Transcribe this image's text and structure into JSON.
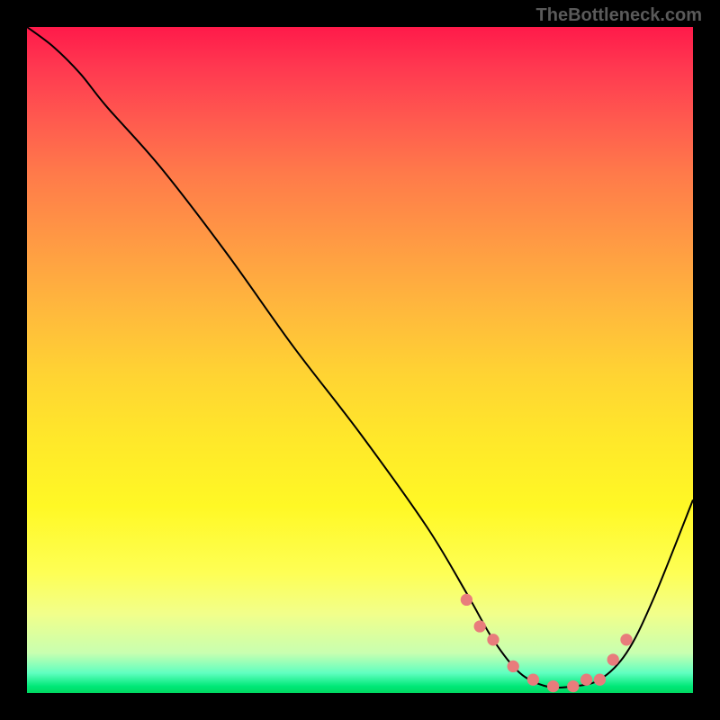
{
  "watermark": "TheBottleneck.com",
  "colors": {
    "background": "#000000",
    "curve": "#000000",
    "dots": "#e87c7c"
  },
  "chart_data": {
    "type": "line",
    "title": "",
    "xlabel": "",
    "ylabel": "",
    "xlim": [
      0,
      100
    ],
    "ylim": [
      0,
      100
    ],
    "series": [
      {
        "name": "bottleneck-curve",
        "x": [
          0,
          4,
          8,
          12,
          20,
          30,
          40,
          50,
          60,
          66,
          70,
          74,
          78,
          82,
          86,
          90,
          94,
          100
        ],
        "y": [
          100,
          97,
          93,
          88,
          79,
          66,
          52,
          39,
          25,
          15,
          8,
          3,
          1,
          1,
          2,
          6,
          14,
          29
        ]
      }
    ],
    "marker_points": {
      "x": [
        66,
        68,
        70,
        73,
        76,
        79,
        82,
        84,
        86,
        88,
        90
      ],
      "y": [
        14,
        10,
        8,
        4,
        2,
        1,
        1,
        2,
        2,
        5,
        8
      ]
    }
  }
}
